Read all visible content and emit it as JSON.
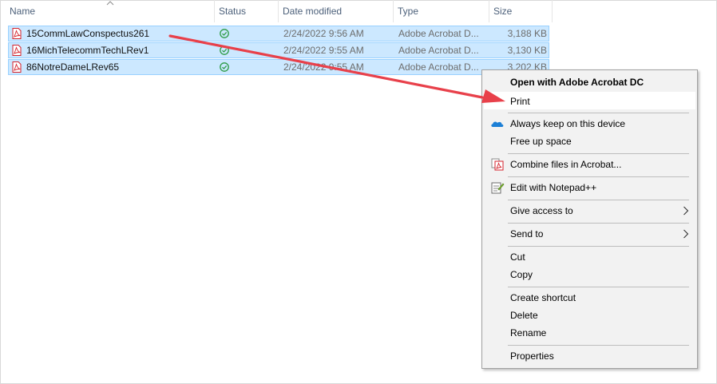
{
  "columns": {
    "name": "Name",
    "status": "Status",
    "date_modified": "Date modified",
    "type": "Type",
    "size": "Size"
  },
  "files": [
    {
      "name": "15CommLawConspectus261",
      "date": "2/24/2022 9:56 AM",
      "type": "Adobe Acrobat D...",
      "size": "3,188 KB",
      "status_icon": "synced-check-icon"
    },
    {
      "name": "16MichTelecommTechLRev1",
      "date": "2/24/2022 9:55 AM",
      "type": "Adobe Acrobat D...",
      "size": "3,130 KB",
      "status_icon": "synced-check-icon"
    },
    {
      "name": "86NotreDameLRev65",
      "date": "2/24/2022 9:55 AM",
      "type": "Adobe Acrobat D...",
      "size": "3,202 KB",
      "status_icon": "synced-check-icon"
    }
  ],
  "context_menu": {
    "open_with": "Open with Adobe Acrobat DC",
    "print": "Print",
    "always_keep": "Always keep on this device",
    "free_up": "Free up space",
    "combine": "Combine files in Acrobat...",
    "edit_notepad": "Edit with Notepad++",
    "give_access": "Give access to",
    "send_to": "Send to",
    "cut": "Cut",
    "copy": "Copy",
    "create_shortcut": "Create shortcut",
    "delete": "Delete",
    "rename": "Rename",
    "properties": "Properties"
  },
  "colors": {
    "selection_bg": "#cce8ff",
    "selection_border": "#99d1ff",
    "menu_bg": "#f2f2f2",
    "arrow": "#e8404a",
    "status_green": "#2e9c47",
    "onedrive_blue": "#1c7fd6",
    "pdf_red": "#d4232c"
  }
}
